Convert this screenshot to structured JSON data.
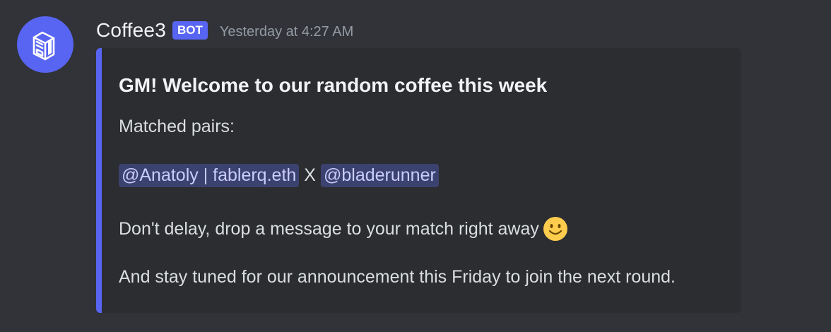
{
  "message": {
    "username": "Coffee3",
    "bot_tag": "BOT",
    "timestamp": "Yesterday at 4:27 AM"
  },
  "embed": {
    "title": "GM! Welcome to our random coffee this week",
    "matched_label": "Matched pairs:",
    "pair": {
      "mention_1": "@Anatoly | fablerq.eth",
      "separator": "X",
      "mention_2": "@bladerunner"
    },
    "line_delay": "Don't delay, drop a message to your match right away",
    "line_announcement": "And stay tuned for our announcement this Friday to join the next round."
  },
  "icons": {
    "avatar": "coffee-machine-icon",
    "emoji": "slightly-smiling-face-icon"
  },
  "colors": {
    "background": "#313338",
    "embed_background": "#2b2d31",
    "accent": "#5865f2",
    "mention_bg": "#3c4270",
    "mention_text": "#c9cdfb"
  }
}
